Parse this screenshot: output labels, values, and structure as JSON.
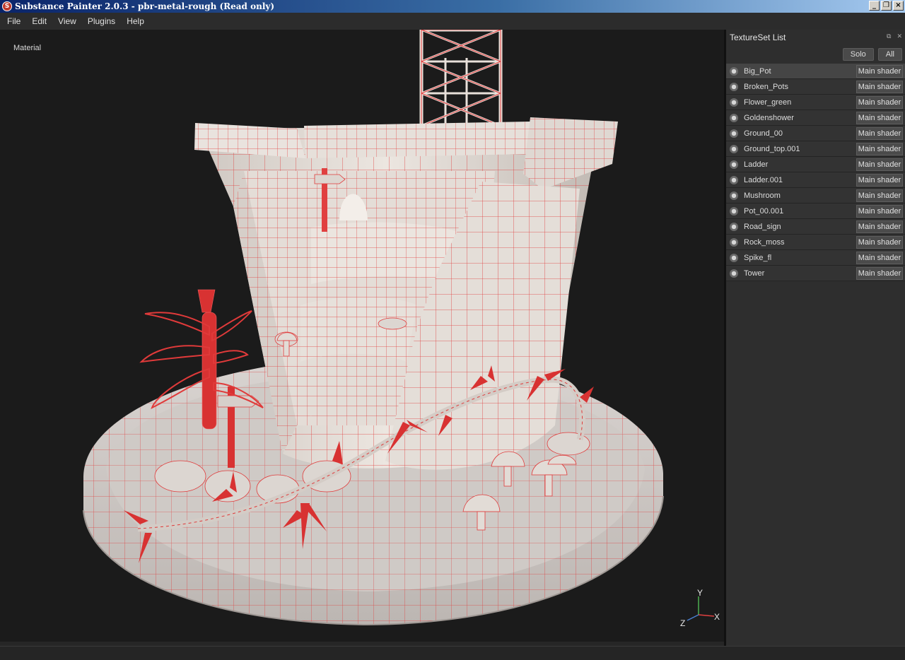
{
  "window": {
    "title": "Substance Painter 2.0.3 - pbr-metal-rough (Read only)",
    "icon": "substance-painter-icon",
    "buttons": [
      "minimize",
      "restore",
      "close"
    ]
  },
  "menu": {
    "items": [
      "File",
      "Edit",
      "View",
      "Plugins",
      "Help"
    ]
  },
  "viewport": {
    "mode_label": "Material",
    "axis": {
      "x": "X",
      "y": "Y",
      "z": "Z"
    },
    "colors": {
      "mesh": "#e8e2dc",
      "wireframe": "#e03030",
      "plant": "#d83232",
      "background": "#1b1b1b"
    }
  },
  "textureset_panel": {
    "title": "TextureSet List",
    "solo_label": "Solo",
    "all_label": "All",
    "items": [
      {
        "name": "Big_Pot",
        "shader": "Main shader",
        "selected": true
      },
      {
        "name": "Broken_Pots",
        "shader": "Main shader"
      },
      {
        "name": "Flower_green",
        "shader": "Main shader"
      },
      {
        "name": "Goldenshower",
        "shader": "Main shader"
      },
      {
        "name": "Ground_00",
        "shader": "Main shader"
      },
      {
        "name": "Ground_top.001",
        "shader": "Main shader"
      },
      {
        "name": "Ladder",
        "shader": "Main shader"
      },
      {
        "name": "Ladder.001",
        "shader": "Main shader"
      },
      {
        "name": "Mushroom",
        "shader": "Main shader"
      },
      {
        "name": "Pot_00.001",
        "shader": "Main shader"
      },
      {
        "name": "Road_sign",
        "shader": "Main shader"
      },
      {
        "name": "Rock_moss",
        "shader": "Main shader"
      },
      {
        "name": "Spike_fl",
        "shader": "Main shader"
      },
      {
        "name": "Tower",
        "shader": "Main shader"
      }
    ]
  }
}
